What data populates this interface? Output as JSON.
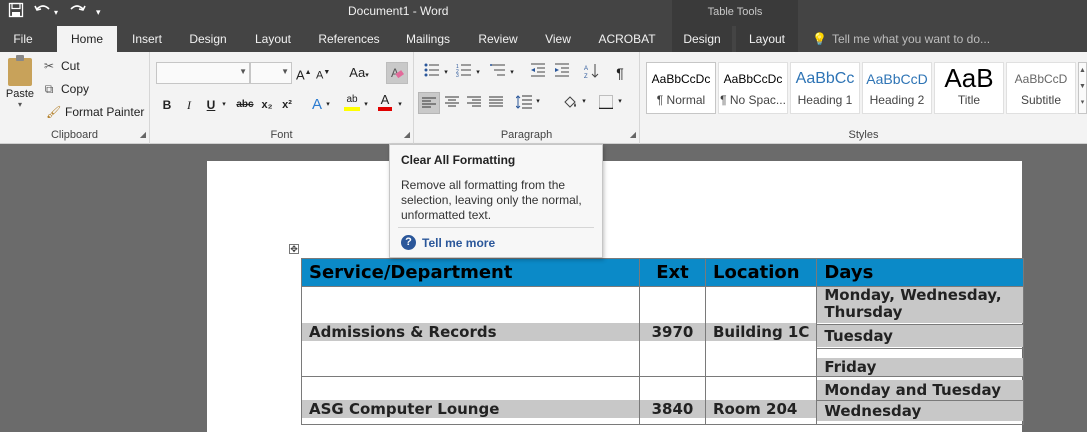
{
  "window": {
    "title": "Document1 - Word",
    "contextual_group": "Table Tools"
  },
  "qat": {
    "save_icon": "save-icon",
    "undo_icon": "undo-icon",
    "redo_icon": "redo-icon",
    "customize_icon": "customize-qat-icon"
  },
  "tabs": [
    {
      "label": "File"
    },
    {
      "label": "Home"
    },
    {
      "label": "Insert"
    },
    {
      "label": "Design"
    },
    {
      "label": "Layout"
    },
    {
      "label": "References"
    },
    {
      "label": "Mailings"
    },
    {
      "label": "Review"
    },
    {
      "label": "View"
    },
    {
      "label": "ACROBAT"
    },
    {
      "label": "Design"
    },
    {
      "label": "Layout"
    }
  ],
  "active_tab": "Home",
  "tell_me": {
    "placeholder": "Tell me what you want to do..."
  },
  "ribbon": {
    "clipboard": {
      "label": "Clipboard",
      "paste": "Paste",
      "cut": "Cut",
      "copy": "Copy",
      "format_painter": "Format Painter"
    },
    "font": {
      "label": "Font",
      "font_name": "",
      "font_size": "",
      "grow": "A",
      "shrink": "A",
      "change_case": "Aa",
      "bold": "B",
      "italic": "I",
      "underline": "U",
      "strikethrough": "abc",
      "subscript": "x₂",
      "superscript": "x²",
      "text_effects": "A",
      "highlight": "ab",
      "font_color": "A"
    },
    "paragraph": {
      "label": "Paragraph"
    },
    "styles": {
      "label": "Styles",
      "items": [
        {
          "sample": "AaBbCcDc",
          "name": "¶ Normal"
        },
        {
          "sample": "AaBbCcDc",
          "name": "¶ No Spac..."
        },
        {
          "sample": "AaBbCc",
          "name": "Heading 1"
        },
        {
          "sample": "AaBbCcD",
          "name": "Heading 2"
        },
        {
          "sample": "AaB",
          "name": "Title"
        },
        {
          "sample": "AaBbCcD",
          "name": "Subtitle"
        }
      ]
    }
  },
  "tooltip": {
    "title": "Clear All Formatting",
    "body": "Remove all formatting from the selection, leaving only the normal, unformatted text.",
    "link": "Tell me more"
  },
  "table": {
    "headers": [
      "Service/Department",
      "Ext",
      "Location",
      "Days"
    ],
    "rows": [
      {
        "service": "Admissions & Records",
        "ext": "3970",
        "location": "Building 1C",
        "days": [
          "Monday, Wednesday, Thursday",
          "Tuesday",
          "Friday"
        ]
      },
      {
        "service": "ASG Computer Lounge",
        "ext": "3840",
        "location": "Room 204",
        "days": [
          "Monday and Tuesday",
          "Wednesday"
        ]
      }
    ]
  },
  "colors": {
    "title_bar": "#444444",
    "ribbon": "#f3f3f3",
    "table_header": "#0b8ac8",
    "cell_highlight": "#c8c8c8",
    "link": "#2b579a"
  }
}
